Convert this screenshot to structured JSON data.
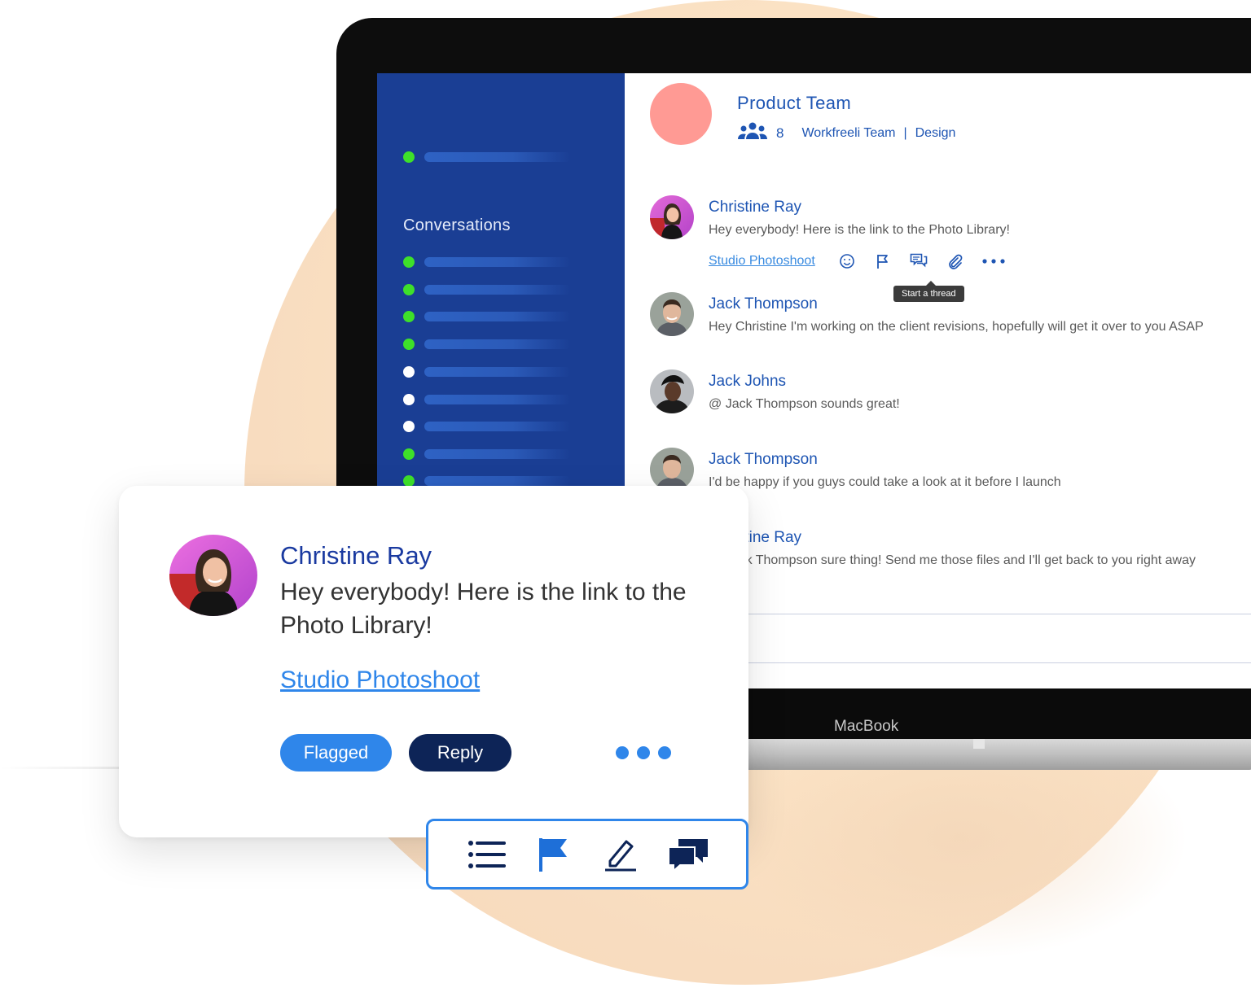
{
  "sidebar": {
    "title": "Conversations",
    "status_colors": {
      "online": "#3ee02a",
      "offline": "#ffffff"
    },
    "items": [
      "online",
      "online",
      "online",
      "online",
      "offline",
      "offline",
      "offline",
      "online",
      "online"
    ]
  },
  "header": {
    "group_name": "Product Team",
    "member_count": "8",
    "team": "Workfreeli Team",
    "separator": "|",
    "channel": "Design",
    "icon": "people-icon"
  },
  "messages": [
    {
      "name": "Christine Ray",
      "text": "Hey everybody! Here is the link to the Photo Library!"
    },
    {
      "name": "Jack Thompson",
      "text": "Hey Christine I'm working on the client revisions, hopefully will get it over to you ASAP"
    },
    {
      "name": "Jack Johns",
      "text": "@ Jack Thompson sounds great!"
    },
    {
      "name": "Jack Thompson",
      "text": "I'd be happy if you guys could take a look at it before I launch"
    },
    {
      "name": "Christine Ray",
      "text": "@ Jack Thompson sure thing! Send me those files and I'll get back to you right away"
    }
  ],
  "message_actions": {
    "link": "Studio Photoshoot",
    "icons": [
      "emoji-icon",
      "flag-icon",
      "thread-icon",
      "attachment-icon",
      "more-icon"
    ],
    "tooltip": "Start a thread"
  },
  "device_label": "MacBook",
  "card": {
    "name": "Christine Ray",
    "text": "Hey everybody! Here is the link to the Photo Library!",
    "link": "Studio Photoshoot",
    "flagged_label": "Flagged",
    "reply_label": "Reply",
    "more_icon": "more-dots-icon"
  },
  "toolbar": {
    "icons": [
      "list-icon",
      "flag-icon",
      "edit-icon",
      "chat-icon"
    ]
  },
  "colors": {
    "accent": "#2f86ea",
    "brand_dark": "#0d2457",
    "sidebar_bg": "#1a3e94",
    "link_blue": "#1e55b3",
    "group_avatar": "#ff9a94"
  }
}
